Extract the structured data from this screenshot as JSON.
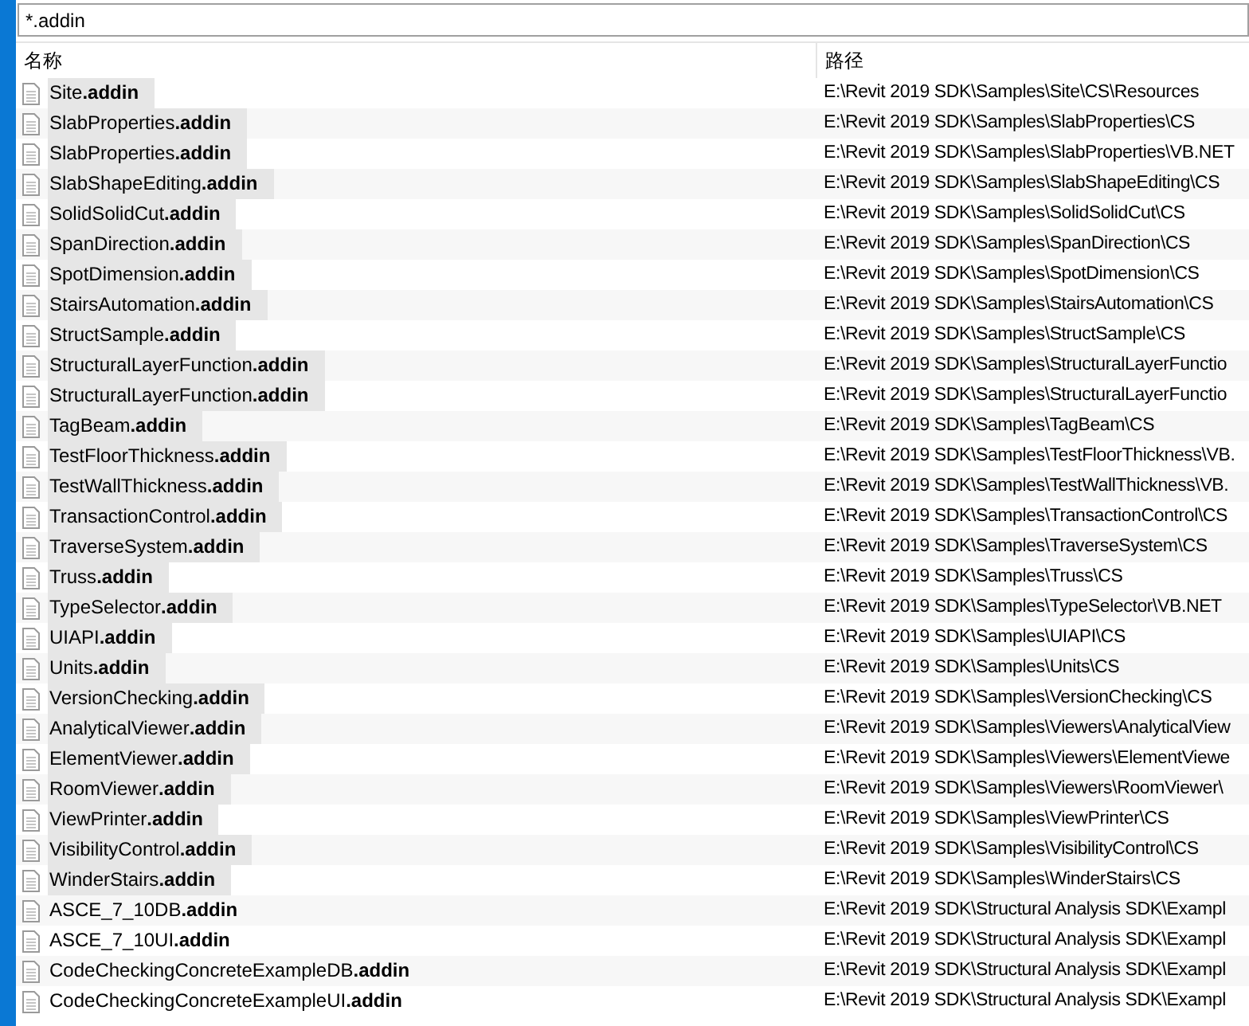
{
  "search": {
    "value": "*.addin"
  },
  "table": {
    "columns": [
      "名称",
      "路径"
    ],
    "rows": [
      {
        "name": "Site**.addin**",
        "path": "E:\\Revit 2019 SDK\\Samples\\Site\\CS\\Resources",
        "highlighted": true
      },
      {
        "name": "SlabProperties**.addin**",
        "path": "E:\\Revit 2019 SDK\\Samples\\SlabProperties\\CS",
        "highlighted": true
      },
      {
        "name": "SlabProperties**.addin**",
        "path": "E:\\Revit 2019 SDK\\Samples\\SlabProperties\\VB.NET",
        "highlighted": true
      },
      {
        "name": "SlabShapeEditing**.addin**",
        "path": "E:\\Revit 2019 SDK\\Samples\\SlabShapeEditing\\CS",
        "highlighted": true
      },
      {
        "name": "SolidSolidCut**.addin**",
        "path": "E:\\Revit 2019 SDK\\Samples\\SolidSolidCut\\CS",
        "highlighted": true
      },
      {
        "name": "SpanDirection**.addin**",
        "path": "E:\\Revit 2019 SDK\\Samples\\SpanDirection\\CS",
        "highlighted": true
      },
      {
        "name": "SpotDimension**.addin**",
        "path": "E:\\Revit 2019 SDK\\Samples\\SpotDimension\\CS",
        "highlighted": true
      },
      {
        "name": "StairsAutomation**.addin**",
        "path": "E:\\Revit 2019 SDK\\Samples\\StairsAutomation\\CS",
        "highlighted": true
      },
      {
        "name": "StructSample**.addin**",
        "path": "E:\\Revit 2019 SDK\\Samples\\StructSample\\CS",
        "highlighted": true
      },
      {
        "name": "StructuralLayerFunction**.addin**",
        "path": "E:\\Revit 2019 SDK\\Samples\\StructuralLayerFunctio",
        "highlighted": true
      },
      {
        "name": "StructuralLayerFunction**.addin**",
        "path": "E:\\Revit 2019 SDK\\Samples\\StructuralLayerFunctio",
        "highlighted": true
      },
      {
        "name": "TagBeam**.addin**",
        "path": "E:\\Revit 2019 SDK\\Samples\\TagBeam\\CS",
        "highlighted": true
      },
      {
        "name": "TestFloorThickness**.addin**",
        "path": "E:\\Revit 2019 SDK\\Samples\\TestFloorThickness\\VB.",
        "highlighted": true
      },
      {
        "name": "TestWallThickness**.addin**",
        "path": "E:\\Revit 2019 SDK\\Samples\\TestWallThickness\\VB.",
        "highlighted": true
      },
      {
        "name": "TransactionControl**.addin**",
        "path": "E:\\Revit 2019 SDK\\Samples\\TransactionControl\\CS",
        "highlighted": true
      },
      {
        "name": "TraverseSystem**.addin**",
        "path": "E:\\Revit 2019 SDK\\Samples\\TraverseSystem\\CS",
        "highlighted": true
      },
      {
        "name": "Truss**.addin**",
        "path": "E:\\Revit 2019 SDK\\Samples\\Truss\\CS",
        "highlighted": true
      },
      {
        "name": "TypeSelector**.addin**",
        "path": "E:\\Revit 2019 SDK\\Samples\\TypeSelector\\VB.NET",
        "highlighted": true
      },
      {
        "name": "UIAPI**.addin**",
        "path": "E:\\Revit 2019 SDK\\Samples\\UIAPI\\CS",
        "highlighted": true
      },
      {
        "name": "Units**.addin**",
        "path": "E:\\Revit 2019 SDK\\Samples\\Units\\CS",
        "highlighted": true
      },
      {
        "name": "VersionChecking**.addin**",
        "path": "E:\\Revit 2019 SDK\\Samples\\VersionChecking\\CS",
        "highlighted": true
      },
      {
        "name": "AnalyticalViewer**.addin**",
        "path": "E:\\Revit 2019 SDK\\Samples\\Viewers\\AnalyticalView",
        "highlighted": true
      },
      {
        "name": "ElementViewer**.addin**",
        "path": "E:\\Revit 2019 SDK\\Samples\\Viewers\\ElementViewe",
        "highlighted": true
      },
      {
        "name": "RoomViewer**.addin**",
        "path": "E:\\Revit 2019 SDK\\Samples\\Viewers\\RoomViewer\\",
        "highlighted": true
      },
      {
        "name": "ViewPrinter**.addin**",
        "path": "E:\\Revit 2019 SDK\\Samples\\ViewPrinter\\CS",
        "highlighted": true
      },
      {
        "name": "VisibilityControl**.addin**",
        "path": "E:\\Revit 2019 SDK\\Samples\\VisibilityControl\\CS",
        "highlighted": true
      },
      {
        "name": "WinderStairs**.addin**",
        "path": "E:\\Revit 2019 SDK\\Samples\\WinderStairs\\CS",
        "highlighted": true
      },
      {
        "name": "ASCE_7_10DB**.addin**",
        "path": "E:\\Revit 2019 SDK\\Structural Analysis SDK\\Exampl",
        "highlighted": false
      },
      {
        "name": "ASCE_7_10UI**.addin**",
        "path": "E:\\Revit 2019 SDK\\Structural Analysis SDK\\Exampl",
        "highlighted": false
      },
      {
        "name": "CodeCheckingConcreteExampleDB**.addin**",
        "path": "E:\\Revit 2019 SDK\\Structural Analysis SDK\\Exampl",
        "highlighted": false
      },
      {
        "name": "CodeCheckingConcreteExampleUI**.addin**",
        "path": "E:\\Revit 2019 SDK\\Structural Analysis SDK\\Exampl",
        "highlighted": false
      }
    ]
  }
}
